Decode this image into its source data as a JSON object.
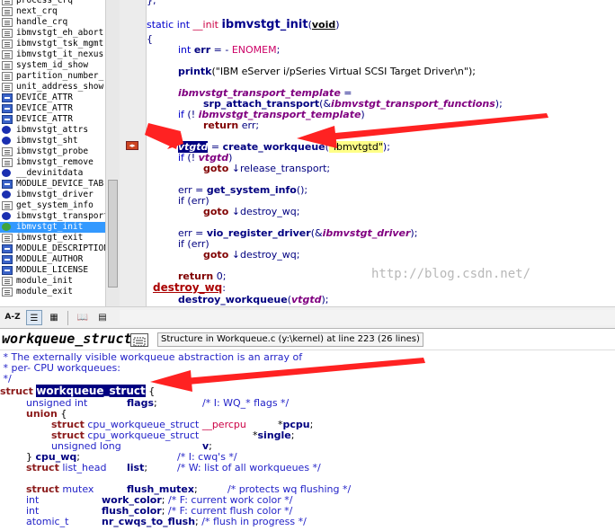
{
  "symbols": [
    {
      "label": "process_crq",
      "icon": "page"
    },
    {
      "label": "next_crq",
      "icon": "page"
    },
    {
      "label": "handle_crq",
      "icon": "page"
    },
    {
      "label": "ibmvstgt_eh_abort",
      "icon": "page"
    },
    {
      "label": "ibmvstgt_tsk_mgmt",
      "icon": "page"
    },
    {
      "label": "ibmvstgt_it_nexus",
      "icon": "page"
    },
    {
      "label": "system_id_show",
      "icon": "page"
    },
    {
      "label": "partition_number_",
      "icon": "page"
    },
    {
      "label": "unit_address_show",
      "icon": "page"
    },
    {
      "label": "DEVICE_ATTR",
      "icon": "def"
    },
    {
      "label": "DEVICE_ATTR",
      "icon": "def"
    },
    {
      "label": "DEVICE_ATTR",
      "icon": "def"
    },
    {
      "label": "ibmvstgt_attrs",
      "icon": "fn"
    },
    {
      "label": "ibmvstgt_sht",
      "icon": "fn"
    },
    {
      "label": "ibmvstgt_probe",
      "icon": "page"
    },
    {
      "label": "ibmvstgt_remove",
      "icon": "page"
    },
    {
      "label": "__devinitdata",
      "icon": "fn"
    },
    {
      "label": "MODULE_DEVICE_TAB",
      "icon": "def"
    },
    {
      "label": "ibmvstgt_driver",
      "icon": "fn"
    },
    {
      "label": "get_system_info",
      "icon": "page"
    },
    {
      "label": "ibmvstgt_transport",
      "icon": "fn"
    },
    {
      "label": "ibmvstgt_init",
      "icon": "green",
      "selected": true
    },
    {
      "label": "ibmvstgt_exit",
      "icon": "page"
    },
    {
      "label": "MODULE_DESCRIPTION",
      "icon": "def"
    },
    {
      "label": "MODULE_AUTHOR",
      "icon": "def"
    },
    {
      "label": "MODULE_LICENSE",
      "icon": "def"
    },
    {
      "label": "module_init",
      "icon": "page"
    },
    {
      "label": "module_exit",
      "icon": "page"
    }
  ],
  "code": {
    "l0": "};",
    "sig_prefix": "static int ",
    "sig_init": "__init",
    "sig_name": "ibmvstgt_init",
    "sig_paren": "(",
    "sig_void": "void",
    "sig_close": ")",
    "brace_open": "{",
    "err_decl_a": "int ",
    "err_decl_b": "err",
    "err_decl_c": " = - ",
    "err_decl_d": "ENOMEM",
    "err_decl_e": ";",
    "printk_fn": "printk",
    "printk_arg": "(\"IBM eServer i/pSeries Virtual SCSI Target Driver\\n\");",
    "tt_name": "ibmvstgt_transport_template",
    "tt_eq": " =",
    "attach_fn": "srp_attach_transport",
    "attach_arg_a": "(&",
    "attach_arg_b": "ibmvstgt_transport_functions",
    "attach_arg_c": ");",
    "if1_a": "if",
    "if1_b": " (! ",
    "if1_c": "ibmvstgt_transport_template",
    "if1_d": ")",
    "ret_kw": "return",
    "ret_val": " err;",
    "wq_var": "vtgtd",
    "wq_eq": " = ",
    "wq_fn": "create_workqueue",
    "wq_arg_a": "(",
    "wq_arg_b": "\"ibmvtgtd\"",
    "wq_arg_c": ");",
    "if2_a": "if",
    "if2_b": " (! ",
    "if2_c": "vtgtd",
    "if2_d": ")",
    "goto_kw": "goto",
    "goto1": " ↓release_transport;",
    "err_assign1_a": "err = ",
    "err_assign1_b": "get_system_info",
    "err_assign1_c": "();",
    "if3": "if (err)",
    "goto2": " ↓destroy_wq;",
    "err_assign2_a": "err = ",
    "err_assign2_b": "vio_register_driver",
    "err_assign2_c": "(&",
    "err_assign2_d": "ibmvstgt_driver",
    "err_assign2_e": ");",
    "if4": "if (err)",
    "goto3": " ↓destroy_wq;",
    "ret0_kw": "return",
    "ret0_val": " 0;",
    "label1": "destroy_wq",
    "label1_colon": ":",
    "destroy_fn": "destroy_workqueue",
    "destroy_arg_a": "(",
    "destroy_arg_b": "vtgtd",
    "destroy_arg_c": ");",
    "watermark": "http://blog.csdn.net/"
  },
  "toolbar": {
    "az_label": "A-Z"
  },
  "context": {
    "symbol_name": "workqueue_struct",
    "info": "Structure in Workqueue.c (y:\\kernel) at line 223 (26 lines)"
  },
  "ctxcode": {
    "c1": " * The externally visible workqueue abstraction is an array of",
    "c2": " * per- CPU workqueues:",
    "c3": " */",
    "s_kw": "struct",
    "s_name": "workqueue_struct",
    "s_brace": " {",
    "f1_type": "unsigned int",
    "f1_name": "flags",
    "f1_cmt": "/* I: WQ_* flags */",
    "u_kw": "union",
    "u_brace": " {",
    "f2_kw": "struct",
    "f2_type": " cpu_workqueue_struct ",
    "f2_pcpu": "__percpu",
    "f2_name": "pcpu",
    "f2_semi": ";",
    "f3_kw": "struct",
    "f3_type": " cpu_workqueue_struct",
    "f3_name": "single",
    "f3_semi": ";",
    "f4_type": "unsigned long",
    "f4_name": "v",
    "f4_semi": ";",
    "u_close_a": "} ",
    "u_close_b": "cpu_wq",
    "u_close_c": ";",
    "u_cmt": "/* I: cwq's */",
    "f5_kw": "struct",
    "f5_type": " list_head",
    "f5_name": "list",
    "f5_semi": ";",
    "f5_cmt": "/* W: list of all workqueues */",
    "f6_kw": "struct",
    "f6_type": " mutex",
    "f6_name": "flush_mutex",
    "f6_semi": ";",
    "f6_cmt": "/* protects wq flushing */",
    "f7_type": "int",
    "f7_name": "work_color",
    "f7_semi": ";",
    "f7_cmt": "/* F: current work color */",
    "f8_type": "int",
    "f8_name": "flush_color",
    "f8_semi": ";",
    "f8_cmt": "/* F: current flush color */",
    "f9_type": "atomic_t",
    "f9_name": "nr_cwqs_to_flush",
    "f9_semi": ";",
    "f9_cmt": "/* flush in progress */"
  },
  "colors": {
    "selection": "#3399ff",
    "arrow": "#ff2222",
    "keyword": "#0000cc"
  }
}
